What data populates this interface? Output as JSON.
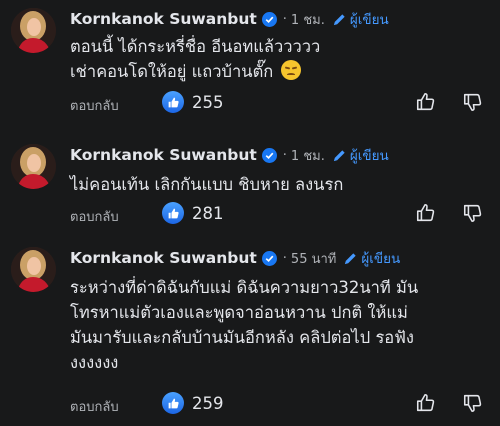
{
  "comments": [
    {
      "author": "Kornkanok Suwanbut",
      "dot": "·",
      "time": "1 ชม.",
      "author_label": "ผู้เขียน",
      "lines": [
        "ตอนนี้ ได้กระหรี่ชื่อ อีนอทแล้ววววว",
        "เช่าคอนโดให้อยู่ แถวบ้านตั๊ก"
      ],
      "emoji": "pensive-face",
      "reply_label": "ตอบกลับ",
      "likes": "255"
    },
    {
      "author": "Kornkanok Suwanbut",
      "dot": "·",
      "time": "1 ชม.",
      "author_label": "ผู้เขียน",
      "lines": [
        "ไม่คอนเท้น เลิกกันแบบ ชิบหาย ลงนรก"
      ],
      "reply_label": "ตอบกลับ",
      "likes": "281"
    },
    {
      "author": "Kornkanok Suwanbut",
      "dot": "·",
      "time": "55 นาที",
      "author_label": "ผู้เขียน",
      "lines": [
        "ระหว่างที่ด่าดิฉันกับแม่ ดิฉันความยาว32นาที มัน",
        "โทรหาแม่ตัวเองและพูดจาอ่อนหวาน ปกติ ให้แม่",
        "มันมารับและกลับบ้านมันอีกหลัง คลิปต่อไป รอฟัง",
        "งงงงงง"
      ],
      "reply_label": "ตอบกลับ",
      "likes": "259"
    }
  ],
  "colors": {
    "background": "#18191a",
    "text": "#e4e6eb",
    "secondary": "#b0b3b8",
    "accent": "#4599ff"
  }
}
